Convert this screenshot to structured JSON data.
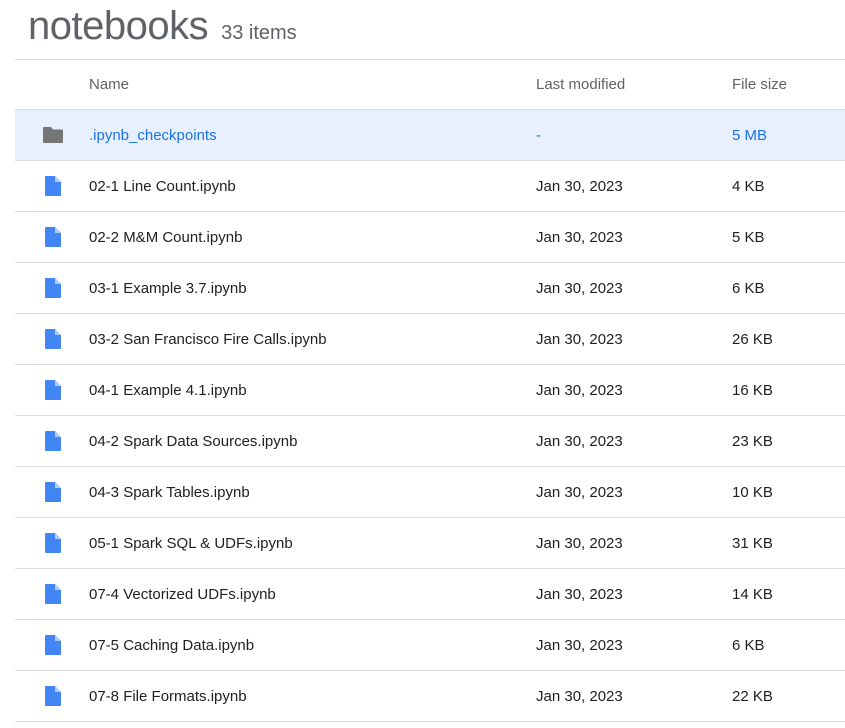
{
  "header": {
    "title": "notebooks",
    "count": "33 items"
  },
  "columns": {
    "name": "Name",
    "modified": "Last modified",
    "size": "File size"
  },
  "colors": {
    "folder": "#757575",
    "file": "#4285f4",
    "selected_bg": "#e8f0fe",
    "selected_text": "#1a73e8"
  },
  "rows": [
    {
      "type": "folder",
      "icon": "folder-icon",
      "name": ".ipynb_checkpoints",
      "modified": "-",
      "size": "5 MB",
      "selected": true
    },
    {
      "type": "file",
      "icon": "file-icon",
      "name": "02-1 Line Count.ipynb",
      "modified": "Jan 30, 2023",
      "size": "4 KB"
    },
    {
      "type": "file",
      "icon": "file-icon",
      "name": "02-2 M&M Count.ipynb",
      "modified": "Jan 30, 2023",
      "size": "5 KB"
    },
    {
      "type": "file",
      "icon": "file-icon",
      "name": "03-1 Example 3.7.ipynb",
      "modified": "Jan 30, 2023",
      "size": "6 KB"
    },
    {
      "type": "file",
      "icon": "file-icon",
      "name": "03-2 San Francisco Fire Calls.ipynb",
      "modified": "Jan 30, 2023",
      "size": "26 KB"
    },
    {
      "type": "file",
      "icon": "file-icon",
      "name": "04-1 Example 4.1.ipynb",
      "modified": "Jan 30, 2023",
      "size": "16 KB"
    },
    {
      "type": "file",
      "icon": "file-icon",
      "name": "04-2 Spark Data Sources.ipynb",
      "modified": "Jan 30, 2023",
      "size": "23 KB"
    },
    {
      "type": "file",
      "icon": "file-icon",
      "name": "04-3 Spark Tables.ipynb",
      "modified": "Jan 30, 2023",
      "size": "10 KB"
    },
    {
      "type": "file",
      "icon": "file-icon",
      "name": "05-1 Spark SQL & UDFs.ipynb",
      "modified": "Jan 30, 2023",
      "size": "31 KB"
    },
    {
      "type": "file",
      "icon": "file-icon",
      "name": "07-4 Vectorized UDFs.ipynb",
      "modified": "Jan 30, 2023",
      "size": "14 KB"
    },
    {
      "type": "file",
      "icon": "file-icon",
      "name": "07-5 Caching Data.ipynb",
      "modified": "Jan 30, 2023",
      "size": "6 KB"
    },
    {
      "type": "file",
      "icon": "file-icon",
      "name": "07-8 File Formats.ipynb",
      "modified": "Jan 30, 2023",
      "size": "22 KB"
    }
  ]
}
